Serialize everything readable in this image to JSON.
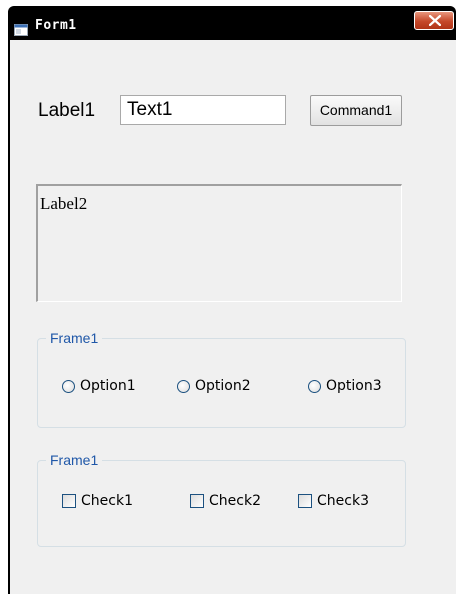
{
  "window": {
    "title": "Form1",
    "close_glyph": "X"
  },
  "label1": "Label1",
  "text1": {
    "value": "Text1"
  },
  "command1": "Command1",
  "label2": "Label2",
  "frames": [
    {
      "legend": "Frame1",
      "options": [
        "Option1",
        "Option2",
        "Option3"
      ]
    },
    {
      "legend": "Frame1",
      "checks": [
        "Check1",
        "Check2",
        "Check3"
      ]
    }
  ],
  "colors": {
    "titlebar": "#000000",
    "client": "#f0f0f0",
    "frame_legend": "#1f57a8",
    "close_button": "#c5482a"
  },
  "icons": {
    "app": "form-window-icon",
    "close": "close-icon"
  }
}
